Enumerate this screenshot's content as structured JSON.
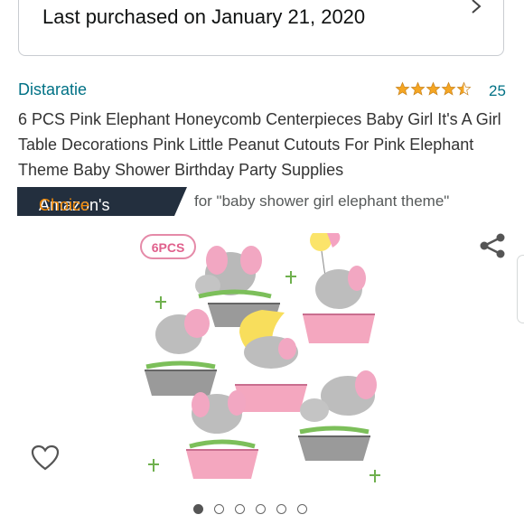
{
  "purchase": {
    "text": "Last purchased on January 21, 2020"
  },
  "product": {
    "brand": "Distaratie",
    "rating": 4.5,
    "rating_count": "25",
    "title": "6 PCS Pink Elephant Honeycomb Centerpieces Baby Girl It's A Girl Table Decorations Pink Little Peanut Cutouts For Pink Elephant Theme Baby Shower Birthday Party Supplies"
  },
  "badge": {
    "part1": "Amazon's",
    "part2": "Choice",
    "for_text": "for \"baby shower girl elephant theme\""
  },
  "image": {
    "pcs_label": "6PCS"
  },
  "carousel": {
    "count": 6,
    "active_index": 0
  },
  "colors": {
    "link": "#007185",
    "star": "#f5a623",
    "badge_bg": "#232f3e",
    "badge_accent": "#f08804"
  },
  "icons": [
    "chevron-right-icon",
    "star-icon",
    "share-icon",
    "heart-icon"
  ]
}
